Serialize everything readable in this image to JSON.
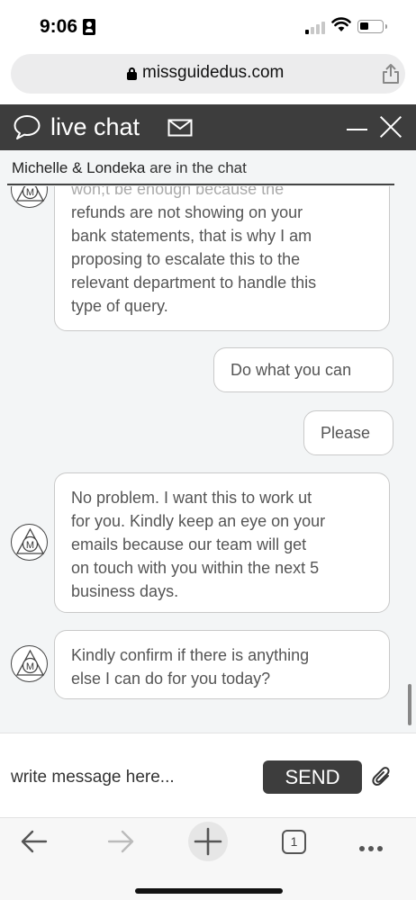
{
  "status_bar": {
    "time": "9:06"
  },
  "browser": {
    "url": "missguidedus.com"
  },
  "chat": {
    "title": "live chat",
    "participants_names": "Michelle & Londeka",
    "participants_suffix": " are in the chat",
    "messages": [
      {
        "sender": "agent",
        "lines": [
          "won;t be enough because the",
          "refunds are not showing on your",
          "bank statements, that is why I am",
          "proposing to escalate this to the",
          "relevant department to handle this",
          "type of query."
        ]
      },
      {
        "sender": "user",
        "lines": [
          "Do what you can"
        ]
      },
      {
        "sender": "user",
        "lines": [
          "Please"
        ]
      },
      {
        "sender": "agent",
        "lines": [
          "No problem. I want this to work ut",
          "for you. Kindly keep an eye on your",
          "emails because our team will get",
          "on touch with you within the next 5",
          "business days."
        ]
      },
      {
        "sender": "agent",
        "lines": [
          "Kindly confirm if there is anything",
          "else I can do for you today?"
        ]
      }
    ],
    "agent_avatar_letter": "M",
    "composer": {
      "placeholder": "write message here...",
      "send_label": "SEND"
    }
  },
  "toolbar": {
    "tab_count": "1"
  }
}
